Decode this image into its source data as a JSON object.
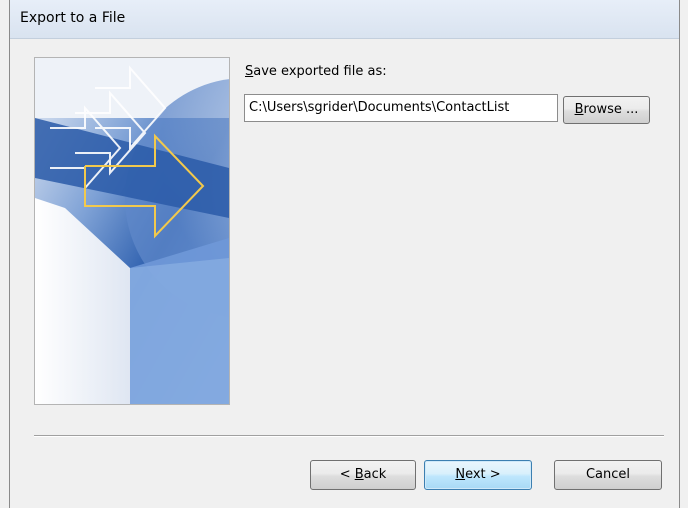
{
  "window": {
    "title": "Export to a File"
  },
  "form": {
    "label_prefix": "",
    "label_mnemonic": "S",
    "label_rest": "ave exported file as:",
    "path_value": "C:\\Users\\sgrider\\Documents\\ContactList",
    "browse_mnemonic": "B",
    "browse_rest": "rowse ..."
  },
  "buttons": {
    "back_prefix": "< ",
    "back_mnemonic": "B",
    "back_rest": "ack",
    "next_mnemonic": "N",
    "next_rest": "ext >",
    "cancel_label": "Cancel"
  },
  "colors": {
    "accent_arrow": "#f2c94c",
    "image_blue_dark": "#1f4f9c",
    "image_blue_light": "#8fb4e4"
  },
  "icons": {
    "wizard_image": "export-arrows-illustration"
  }
}
